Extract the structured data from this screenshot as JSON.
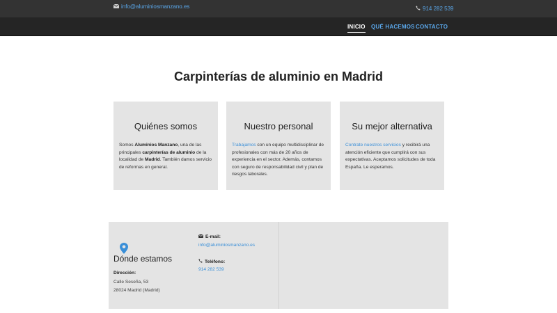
{
  "topbar": {
    "email": "info@aluminiosmanzano.es",
    "phone": "914 282 539"
  },
  "nav": {
    "items": [
      {
        "label": "INICIO",
        "active": true
      },
      {
        "label": "QUÉ HACEMOS",
        "active": false
      },
      {
        "label": "CONTACTO",
        "active": false
      }
    ]
  },
  "main": {
    "title": "Carpinterías de aluminio en Madrid"
  },
  "cards": [
    {
      "title": "Quiénes somos",
      "t1": "Somos ",
      "b1": "Aluminios Manzano",
      "t2": ", una de las principales ",
      "b2": "carpinterías de aluminio",
      "t3": " de la localidad de ",
      "b3": "Madrid",
      "t4": ". También damos servicio de reformas en general."
    },
    {
      "title": "Nuestro personal",
      "link": "Trabajamos",
      "text": " con un equipo multidisciplinar de profesionales con más de 20 años de experiencia en el sector. Además, contamos con seguro de responsabilidad civil y plan de riesgos laborales."
    },
    {
      "title": "Su mejor alternativa",
      "link": "Contrate nuestros servicios",
      "text": " y recibirá una atención eficiente que cumplirá con sus expectativas. Aceptamos solicitudes de toda España. Le esperamos."
    }
  ],
  "footer": {
    "heading": "Dónde estamos",
    "address_label": "Dirección:",
    "address_line1": "Calle Seseña, 53",
    "address_line2": "28024 Madrid (Madrid)",
    "email_label": "E-mail:",
    "email": "info@aluminiosmanzano.es",
    "phone_label": "Teléfono:",
    "phone": "914 282 539"
  },
  "colors": {
    "accent": "#3a8fd8",
    "topbar": "#333333",
    "navbar": "#252525",
    "card_bg": "#e4e4e4"
  },
  "icons": [
    "envelope-icon",
    "phone-icon",
    "map-pin-icon"
  ]
}
